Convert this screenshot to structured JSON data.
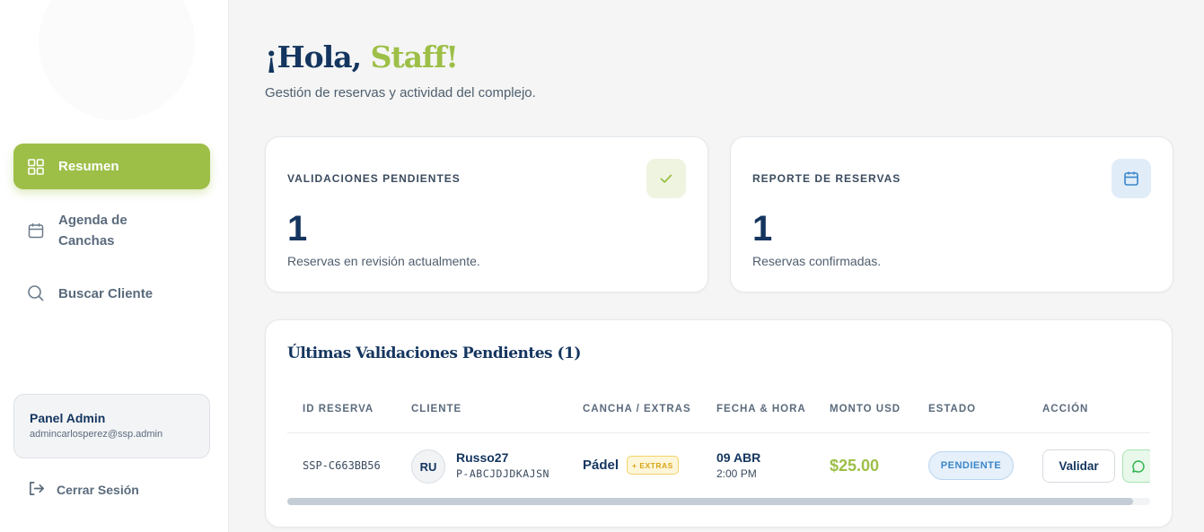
{
  "sidebar": {
    "nav": [
      {
        "label": "Resumen",
        "icon": "grid-icon"
      },
      {
        "label": "Agenda de Canchas",
        "icon": "calendar-icon"
      },
      {
        "label": "Buscar Cliente",
        "icon": "search-icon"
      }
    ],
    "admin": {
      "title": "Panel Admin",
      "email": "admincarlosperez@ssp.admin"
    },
    "logout_label": "Cerrar Sesión"
  },
  "header": {
    "greeting_prefix": "¡Hola, ",
    "greeting_name": "Staff!",
    "subtitle": "Gestión de reservas y actividad del complejo."
  },
  "stats": [
    {
      "label": "VALIDACIONES PENDIENTES",
      "value": "1",
      "description": "Reservas en revisión actualmente.",
      "icon": "check-icon"
    },
    {
      "label": "REPORTE DE RESERVAS",
      "value": "1",
      "description": "Reservas confirmadas.",
      "icon": "calendar-icon"
    }
  ],
  "table": {
    "title": "Últimas Validaciones Pendientes (1)",
    "columns": [
      "ID RESERVA",
      "CLIENTE",
      "CANCHA / EXTRAS",
      "FECHA & HORA",
      "MONTO USD",
      "ESTADO",
      "ACCIÓN"
    ],
    "rows": [
      {
        "id": "SSP-C663BB56",
        "avatar": "RU",
        "client_name": "Russo27",
        "client_code": "P-ABCJDJDKAJSN",
        "court": "Pádel",
        "extras": "+ EXTRAS",
        "date": "09 ABR",
        "time": "2:00 PM",
        "amount": "$25.00",
        "status": "PENDIENTE",
        "action_label": "Validar"
      }
    ],
    "scroll_fraction": 0.98
  },
  "colors": {
    "brand_green": "#9dbf47",
    "navy": "#14355f",
    "status_blue": "#3b86c9",
    "extras_gold": "#d9a517"
  }
}
